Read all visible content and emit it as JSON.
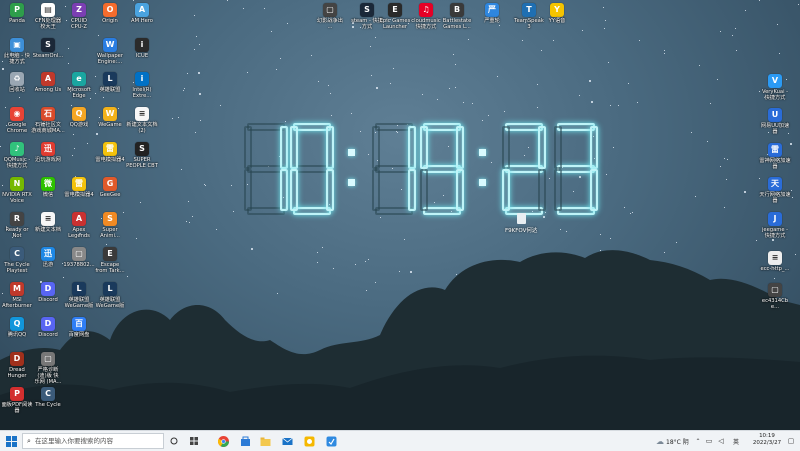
{
  "desktop": {
    "icons_left": [
      {
        "label": "Panda",
        "color": "#2e9e4b",
        "glyph": "P"
      },
      {
        "label": "CFN处理器\n校大王",
        "color": "#ffffff",
        "glyph": "▤"
      },
      {
        "label": "CPUID\nCPU-Z",
        "color": "#7b3fb3",
        "glyph": "Z"
      },
      {
        "label": "Origin",
        "color": "#f56c2d",
        "glyph": "O"
      },
      {
        "label": "AM Hero",
        "color": "#4aa3df",
        "glyph": "A"
      },
      {
        "label": "此电脑 - 快\n捷方式",
        "color": "#3d8fd8",
        "glyph": "▣"
      },
      {
        "label": "SteamOnl...",
        "color": "#1b2838",
        "glyph": "S"
      },
      {
        "label": "Wallpaper\nEngine:...",
        "color": "#2a7de1",
        "glyph": "W"
      },
      {
        "label": "ICUE",
        "color": "#2b2b2b",
        "glyph": "i"
      },
      {
        "label": "回收站",
        "color": "#9aa7b3",
        "glyph": "♻"
      },
      {
        "label": "Among Us",
        "color": "#c0392b",
        "glyph": "A"
      },
      {
        "label": "Microsoft\nEdge",
        "color": "#1aa6a0",
        "glyph": "e"
      },
      {
        "label": "英雄联盟",
        "color": "#1a3a5c",
        "glyph": "L"
      },
      {
        "label": "Intel(R)\nExtre...",
        "color": "#0071c5",
        "glyph": "i"
      },
      {
        "label": "Google\nChrome",
        "color": "#e84335",
        "glyph": "◉"
      },
      {
        "label": "石锤社区文\n游戏商城MA...",
        "color": "#d94b2b",
        "glyph": "石"
      },
      {
        "label": "QQ游戏",
        "color": "#f5a623",
        "glyph": "Q"
      },
      {
        "label": "WeGame",
        "color": "#f3b21a",
        "glyph": "W"
      },
      {
        "label": "新建文本文档\n(2)",
        "color": "#f7f7f7",
        "glyph": "≡"
      },
      {
        "label": "QQMusic -\n快捷方式",
        "color": "#31c27c",
        "glyph": "♪"
      },
      {
        "label": "迅玩游戏网",
        "color": "#e03c31",
        "glyph": "迅"
      },
      {
        "label": "雷电模拟器4",
        "color": "#f4c20d",
        "glyph": "雷"
      },
      {
        "label": "SUPER\nPEOPLE CBT",
        "color": "#222222",
        "glyph": "S"
      },
      {
        "label": "NVIDIA RTX\nVoice",
        "color": "#76b900",
        "glyph": "N"
      },
      {
        "label": "微信",
        "color": "#2dc100",
        "glyph": "微"
      },
      {
        "label": "雷电模拟器4",
        "color": "#f4c20d",
        "glyph": "雷"
      },
      {
        "label": "GeeGee",
        "color": "#e05a2b",
        "glyph": "G"
      },
      {
        "label": "Ready or\nNot",
        "color": "#444444",
        "glyph": "R"
      },
      {
        "label": "新建文本档",
        "color": "#f7f7f7",
        "glyph": "≡"
      },
      {
        "label": "Apex\nLegends",
        "color": "#c93131",
        "glyph": "A"
      },
      {
        "label": "Super\nAnimi...",
        "color": "#f08a24",
        "glyph": "S"
      },
      {
        "label": "The Cycle\nPlaytest",
        "color": "#3b5b7a",
        "glyph": "C"
      },
      {
        "label": "迅游",
        "color": "#1e88e5",
        "glyph": "迅"
      },
      {
        "label": "19378802...",
        "color": "#888888",
        "glyph": "▢"
      },
      {
        "label": "Escape\nfrom Tark...",
        "color": "#3a3a3a",
        "glyph": "E"
      },
      {
        "label": "MSI\nAfterburner",
        "color": "#c0392b",
        "glyph": "M"
      },
      {
        "label": "Discord",
        "color": "#5865f2",
        "glyph": "D"
      },
      {
        "label": "英雄联盟\nWeGame版",
        "color": "#1a3a5c",
        "glyph": "L"
      },
      {
        "label": "英雄联盟\nWeGame版",
        "color": "#1a3a5c",
        "glyph": "L"
      },
      {
        "label": "腾讯QQ",
        "color": "#1296db",
        "glyph": "Q"
      },
      {
        "label": "Discord",
        "color": "#5865f2",
        "glyph": "D"
      },
      {
        "label": "百度网盘",
        "color": "#2f7ef5",
        "glyph": "百"
      },
      {
        "label": "Dread\nHunger",
        "color": "#a0301c",
        "glyph": "D"
      },
      {
        "label": "严格诊断\n(迪)版 快\n乐网 (MA...",
        "color": "#777777",
        "glyph": "▢"
      },
      {
        "label": "面板PDF阅读\n器",
        "color": "#d32f2f",
        "glyph": "P"
      },
      {
        "label": "The Cycle",
        "color": "#3b5b7a",
        "glyph": "C"
      }
    ],
    "icons_top": [
      {
        "label": "幻影战争出\n...",
        "color": "#444444",
        "glyph": "▢"
      },
      {
        "label": "steam - 快捷\n方式",
        "color": "#1b2838",
        "glyph": "S"
      },
      {
        "label": "Epic Games\nLauncher",
        "color": "#2a2a2a",
        "glyph": "E"
      },
      {
        "label": "cloudmusic\n快捷方式",
        "color": "#e60026",
        "glyph": "♫"
      },
      {
        "label": "Battlestate\nGames L...",
        "color": "#3a3a3a",
        "glyph": "B"
      },
      {
        "label": "严重轮",
        "color": "#2e86de",
        "glyph": "严"
      },
      {
        "label": "TeamSpeak\n3",
        "color": "#1f6fb2",
        "glyph": "T"
      },
      {
        "label": "YY语音",
        "color": "#f5c400",
        "glyph": "Y"
      }
    ],
    "icons_right": [
      {
        "label": "VeryKuai -\n快捷方式",
        "color": "#2b9af3",
        "glyph": "V"
      },
      {
        "label": "网易UU加速\n器",
        "color": "#2a6cd8",
        "glyph": "U"
      },
      {
        "label": "雷神网络加速\n器",
        "color": "#2a6cd8",
        "glyph": "雷"
      },
      {
        "label": "天行网络加速\n器",
        "color": "#2a6cd8",
        "glyph": "天"
      },
      {
        "label": "jeegame -\n快捷方式",
        "color": "#2a6cd8",
        "glyph": "J"
      },
      {
        "label": "ecc-http_...",
        "color": "#eeeeee",
        "glyph": "≡"
      },
      {
        "label": "ec4314Cbe...",
        "color": "#444444",
        "glyph": "▢"
      }
    ]
  },
  "clock": {
    "caption": "F9KFOV何达"
  },
  "taskbar": {
    "search_placeholder": "在这里输入你要搜索的内容",
    "weather": "18°C 阴",
    "ime": "英",
    "time": "10:19",
    "date": "2022/3/27"
  }
}
